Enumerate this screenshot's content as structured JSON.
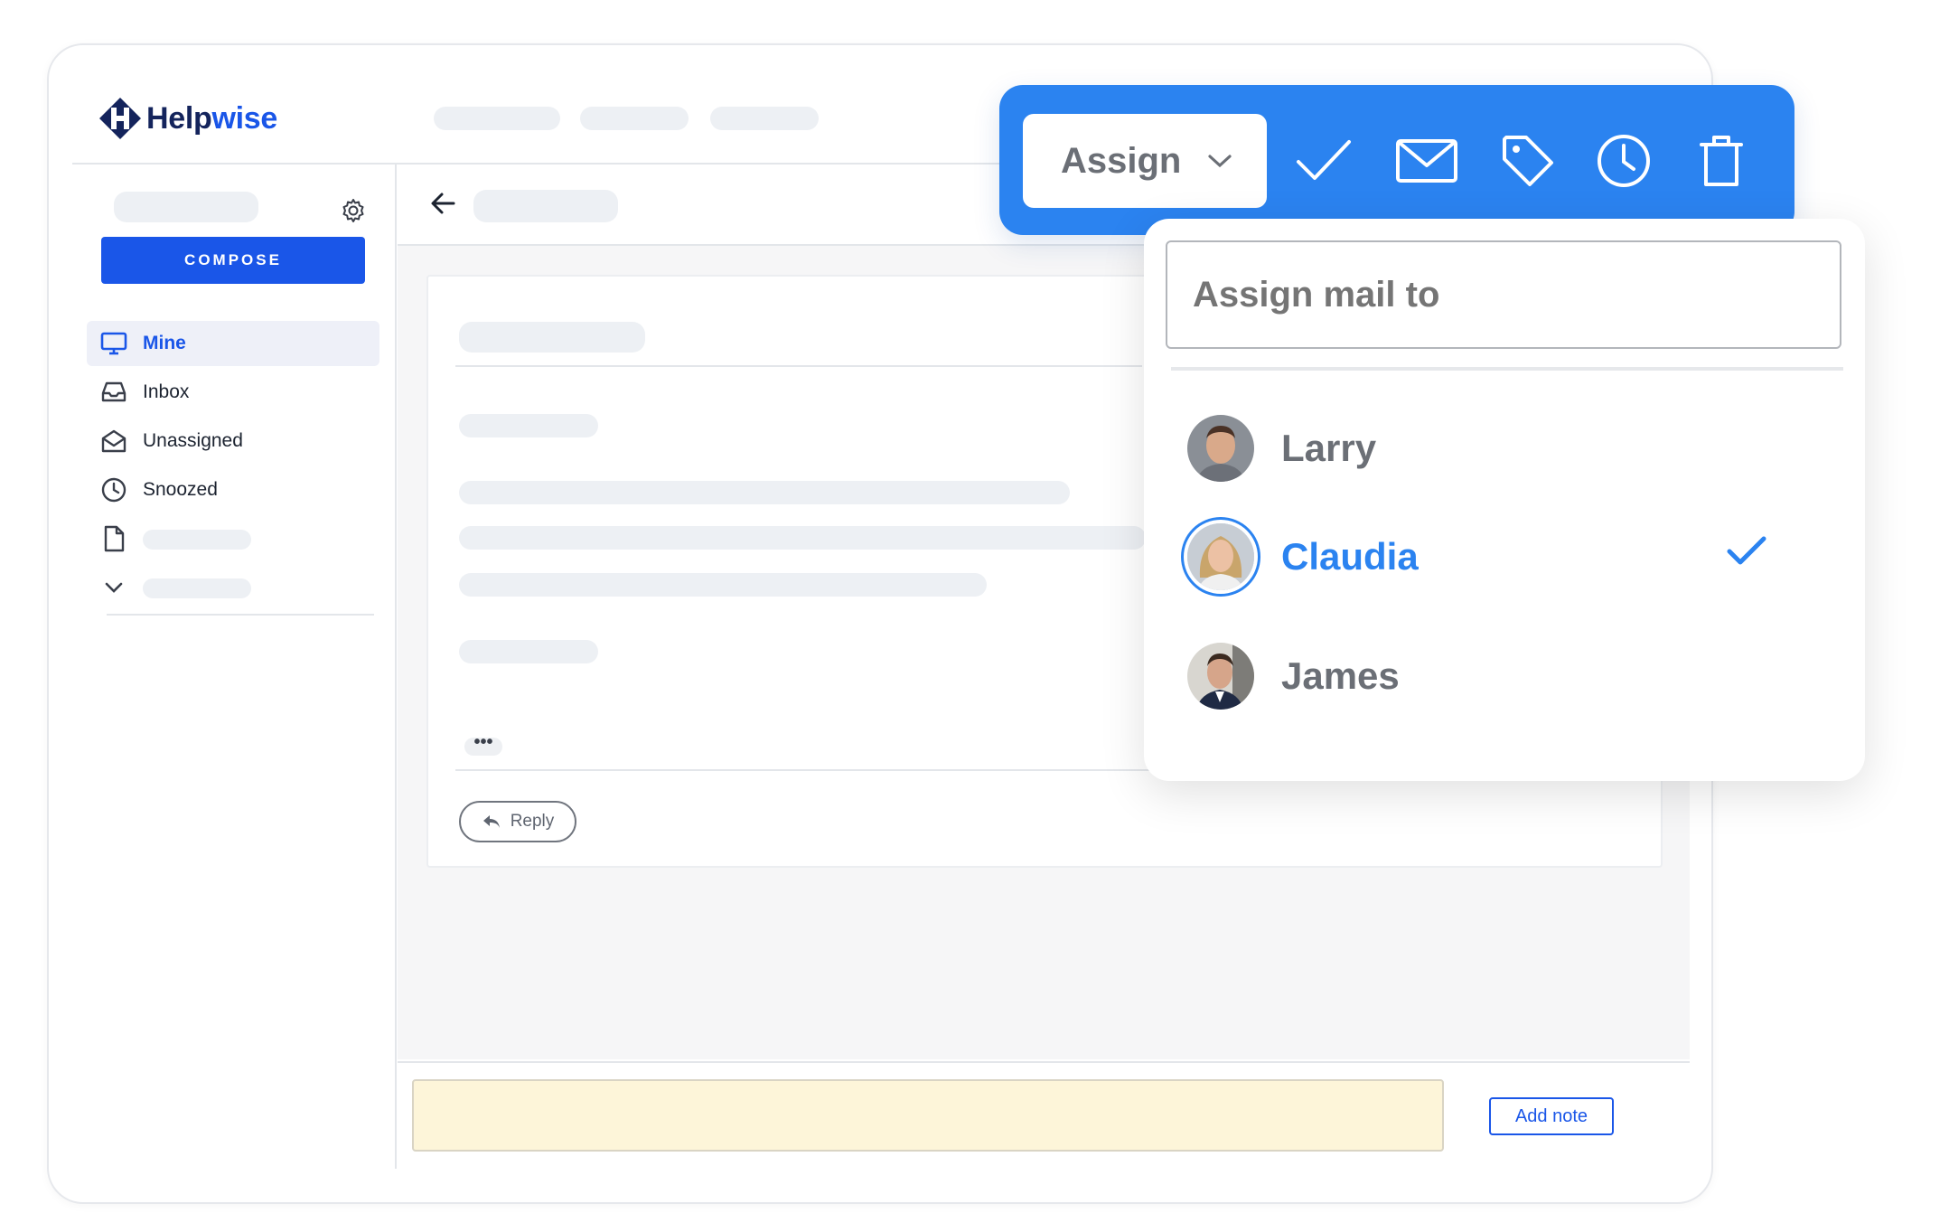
{
  "app": {
    "brand_prefix": "Help",
    "brand_suffix": "wise"
  },
  "sidebar": {
    "compose_label": "COMPOSE",
    "items": [
      {
        "label": "Mine",
        "icon": "monitor-icon",
        "active": true
      },
      {
        "label": "Inbox",
        "icon": "inbox-tray-icon",
        "active": false
      },
      {
        "label": "Unassigned",
        "icon": "open-envelope-icon",
        "active": false
      },
      {
        "label": "Snoozed",
        "icon": "clock-icon",
        "active": false
      }
    ]
  },
  "conversation": {
    "more_label": "•••",
    "reply_label": "Reply",
    "add_note_label": "Add note"
  },
  "toolbar": {
    "assign_label": "Assign",
    "icons": [
      "check-icon",
      "envelope-icon",
      "tag-icon",
      "clock-icon",
      "trash-icon"
    ]
  },
  "assign_dropdown": {
    "placeholder": "Assign mail to",
    "people": [
      {
        "name": "Larry",
        "selected": false
      },
      {
        "name": "Claudia",
        "selected": true
      },
      {
        "name": "James",
        "selected": false
      }
    ]
  },
  "colors": {
    "accent": "#1a56e8",
    "toolbar": "#2b83f0",
    "note": "#fdf5d9"
  }
}
